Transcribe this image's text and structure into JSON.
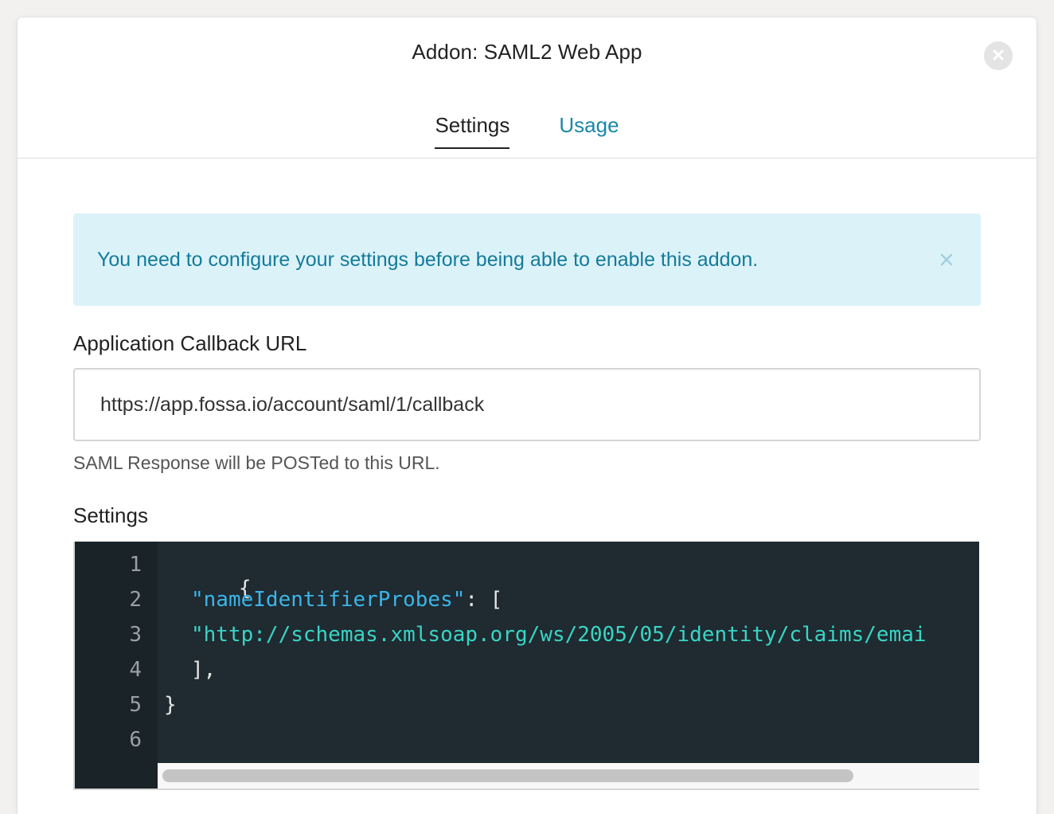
{
  "modal": {
    "title": "Addon: SAML2 Web App"
  },
  "tabs": [
    {
      "label": "Settings",
      "active": true
    },
    {
      "label": "Usage",
      "active": false
    }
  ],
  "alert": {
    "message": "You need to configure your settings before being able to enable this addon."
  },
  "callback": {
    "label": "Application Callback URL",
    "value": "https://app.fossa.io/account/saml/1/callback",
    "help": "SAML Response will be POSTed to this URL."
  },
  "settings": {
    "label": "Settings",
    "line_numbers": [
      "1",
      "2",
      "3",
      "4",
      "5",
      "6"
    ],
    "code": {
      "l1_brace": "{",
      "l2_key": "\"nameIdentifierProbes\"",
      "l2_rest": ": [",
      "l3_string": "\"http://schemas.xmlsoap.org/ws/2005/05/identity/claims/emai",
      "l4": "],",
      "l5": "}"
    }
  },
  "icons": {
    "close_modal": "close-icon",
    "close_alert": "close-icon"
  },
  "colors": {
    "accent": "#1a87a8",
    "alert_bg": "#dcf2f9",
    "editor_bg": "#1f2a31",
    "json_key": "#3bb5e8",
    "json_string": "#39d5c4"
  }
}
